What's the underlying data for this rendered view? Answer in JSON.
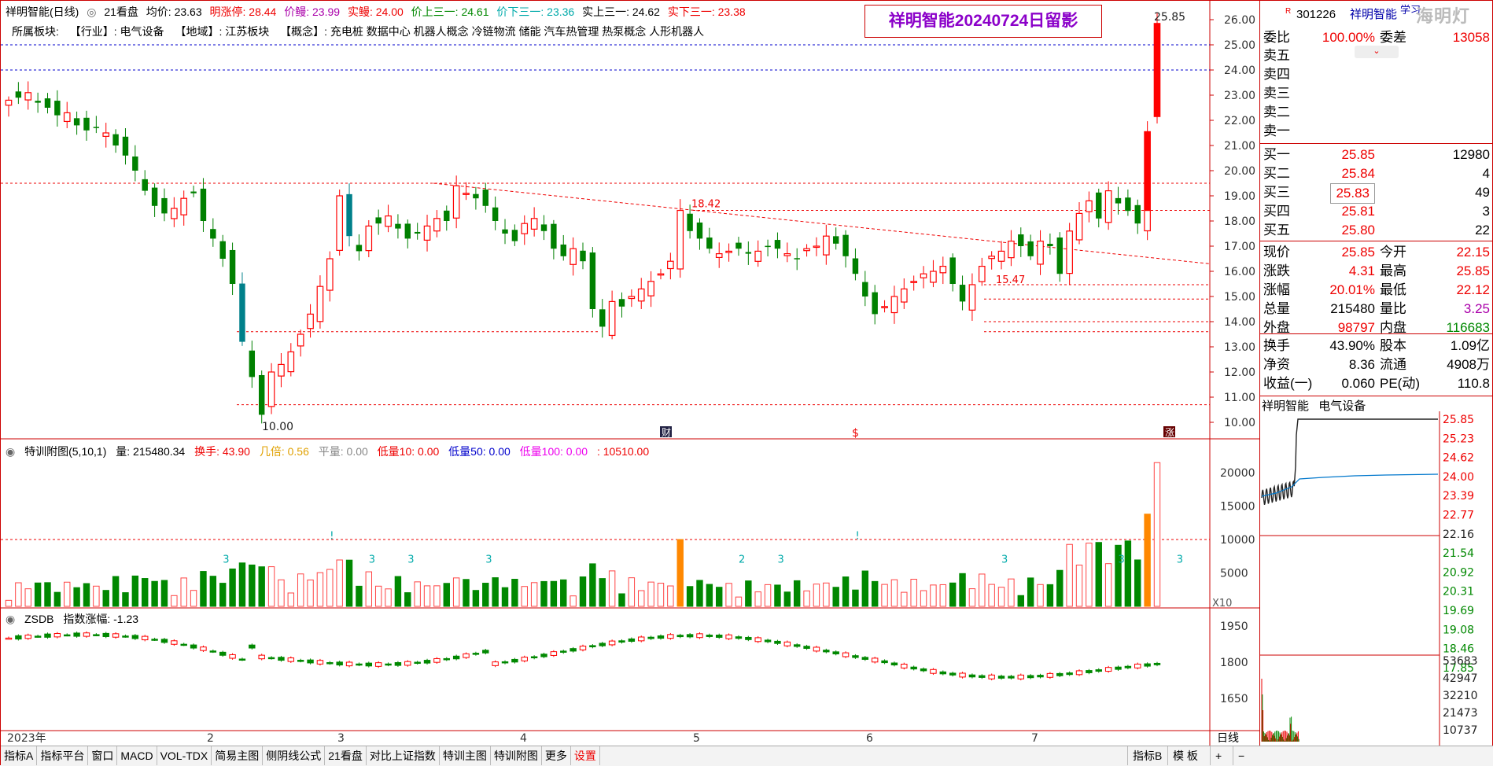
{
  "header": {
    "stock_name": "祥明智能(日线)",
    "gear": "◎",
    "kanpan": "21看盘",
    "avg": "均价: 23.63",
    "ming_zhang_ting": "明涨停: 28.44",
    "jia_bian": "价鳗: 23.99",
    "shi_bian": "实鳗: 24.00",
    "jia_shang": "价上三一: 24.61",
    "jia_xia": "价下三一: 23.36",
    "shi_shang": "实上三一: 24.62",
    "shi_xia": "实下三一: 23.38"
  },
  "sector": {
    "label": "所属板块:",
    "industry": "【行业】: 电气设备",
    "region": "【地域】: 江苏板块",
    "concept": "【概念】: 充电桩 数据中心 机器人概念 冷链物流 储能 汽车热管理 热泵概念 人形机器人"
  },
  "stamp": "祥明智能20240724日留影",
  "main_chart": {
    "price_axis": [
      "26.00",
      "25.00",
      "24.00",
      "23.00",
      "22.00",
      "21.00",
      "20.00",
      "19.00",
      "18.00",
      "17.00",
      "16.00",
      "15.00",
      "14.00",
      "13.00",
      "12.00",
      "11.00",
      "10.00"
    ],
    "annotations": {
      "high": "25.85",
      "low": "10.00",
      "mark1": "18.42",
      "mark2": "15.47"
    },
    "markers": {
      "cai": "财",
      "s": "$",
      "zhang": "涨"
    },
    "colors": {
      "up": "#ff0000",
      "down": "#008000",
      "teal": "#00808a"
    }
  },
  "vol_panel": {
    "title": "特训附图(5,10,1)",
    "vol": "量: 215480.34",
    "huanshou": "换手: 43.90",
    "jibei": "几倍: 0.56",
    "pingliang": "平量: 0.00",
    "dl10": "低量10: 0.00",
    "dl50": "低量50: 0.00",
    "dl100": "低量100: 0.00",
    "tail": ": 10510.00",
    "axis": [
      "20000",
      "15000",
      "10000",
      "5000"
    ],
    "x10": "X10",
    "marks": [
      "3",
      "!",
      "3",
      "3",
      "3",
      "2",
      "3",
      "!",
      "3",
      "3",
      "3"
    ]
  },
  "index_panel": {
    "title": "ZSDB",
    "change": "指数涨幅: -1.23",
    "axis": [
      "1950",
      "1800",
      "1650"
    ]
  },
  "x_axis": [
    "2023年",
    "2",
    "3",
    "4",
    "5",
    "6",
    "7"
  ],
  "toolbar": {
    "items": [
      "指标A",
      "指标平台",
      "窗口",
      "MACD",
      "VOL-TDX",
      "简易主图",
      "侧阴线公式",
      "21看盘",
      "对比上证指数",
      "特训主图",
      "特训附图",
      "更多",
      "设置"
    ],
    "right": [
      "指标B",
      "模 板"
    ],
    "rixian": "日线",
    "plus": "+",
    "minus": "−"
  },
  "side": {
    "code": "301226",
    "name": "祥明智能",
    "tag": "学习",
    "weibi_label": "委比",
    "weibi_val": "100.00%",
    "weicha_label": "委差",
    "weicha_val": "13058",
    "watermark": "海明灯",
    "sells": [
      "卖五",
      "卖四",
      "卖三",
      "卖二",
      "卖一"
    ],
    "buys": [
      {
        "label": "买一",
        "price": "25.85",
        "vol": "12980"
      },
      {
        "label": "买二",
        "price": "25.84",
        "vol": "4"
      },
      {
        "label": "买三",
        "price": "25.83",
        "vol": "49"
      },
      {
        "label": "买四",
        "price": "25.81",
        "vol": "3"
      },
      {
        "label": "买五",
        "price": "25.80",
        "vol": "22"
      }
    ],
    "stats": [
      {
        "l": "现价",
        "v": "25.85",
        "l2": "今开",
        "v2": "22.15"
      },
      {
        "l": "涨跌",
        "v": "4.31",
        "l2": "最高",
        "v2": "25.85"
      },
      {
        "l": "涨幅",
        "v": "20.01%",
        "l2": "最低",
        "v2": "22.12"
      },
      {
        "l": "总量",
        "v": "215480",
        "l2": "量比",
        "v2": "3.25"
      },
      {
        "l": "外盘",
        "v": "98797",
        "l2": "内盘",
        "v2": "116683"
      }
    ],
    "stats2": [
      {
        "l": "换手",
        "v": "43.90%",
        "l2": "股本",
        "v2": "1.09亿"
      },
      {
        "l": "净资",
        "v": "8.36",
        "l2": "流通",
        "v2": "4908万"
      },
      {
        "l": "收益(一)",
        "v": "0.060",
        "l2": "PE(动)",
        "v2": "110.8"
      }
    ],
    "mini_title": "祥明智能",
    "mini_sector": "电气设备",
    "mini_axis": [
      "25.85",
      "25.23",
      "24.62",
      "24.00",
      "23.39",
      "22.77",
      "22.16",
      "21.54",
      "20.92",
      "20.31",
      "19.69",
      "19.08",
      "18.46",
      "17.85"
    ],
    "mini_vol_axis": [
      "53683",
      "42947",
      "32210",
      "21473",
      "10737"
    ]
  }
}
